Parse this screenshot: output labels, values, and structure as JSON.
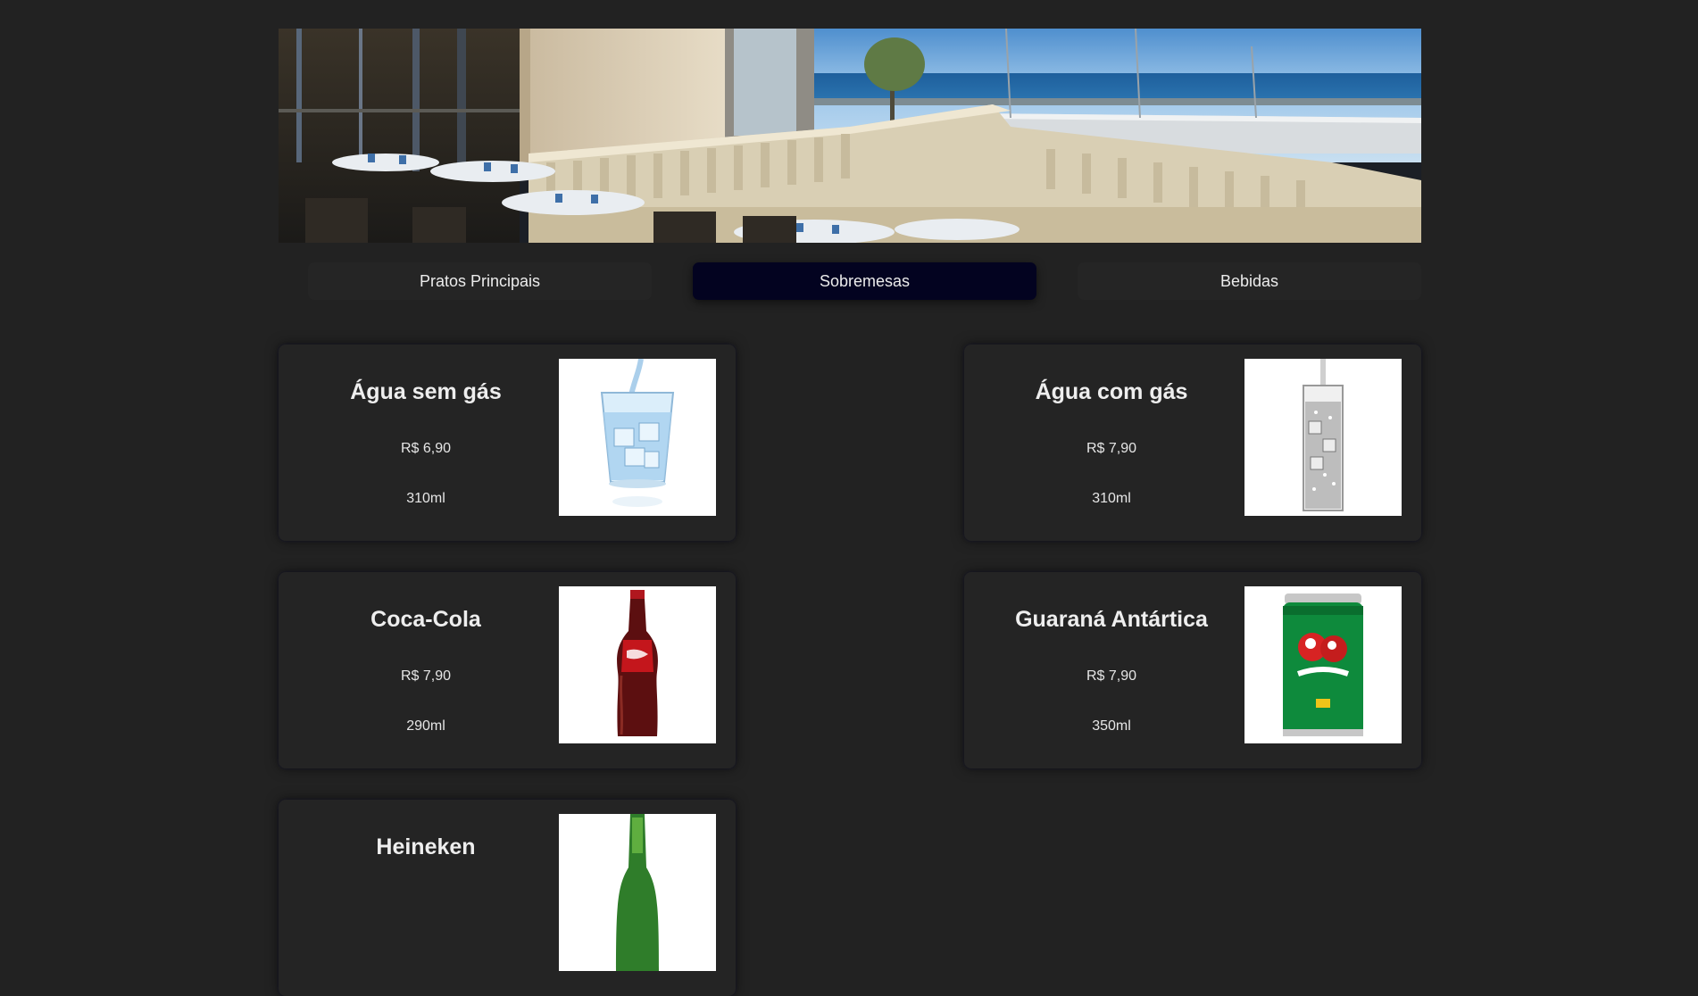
{
  "tabs": [
    {
      "label": "Pratos Principais"
    },
    {
      "label": "Sobremesas"
    },
    {
      "label": "Bebidas"
    }
  ],
  "products": [
    {
      "name": "Água sem gás",
      "price": "R$ 6,90",
      "volume": "310ml",
      "icon": "water-glass-icon"
    },
    {
      "name": "Água com gás",
      "price": "R$ 7,90",
      "volume": "310ml",
      "icon": "sparkling-water-glass-icon"
    },
    {
      "name": "Coca-Cola",
      "price": "R$ 7,90",
      "volume": "290ml",
      "icon": "coca-cola-bottle-icon"
    },
    {
      "name": "Guaraná Antártica",
      "price": "R$ 7,90",
      "volume": "350ml",
      "icon": "guarana-can-icon"
    },
    {
      "name": "Heineken",
      "icon": "heineken-bottle-icon"
    }
  ],
  "colors": {
    "background": "#222222",
    "card": "#242424",
    "tab": "#252525",
    "tab_active": "#030320",
    "text": "#e9e9e9"
  }
}
